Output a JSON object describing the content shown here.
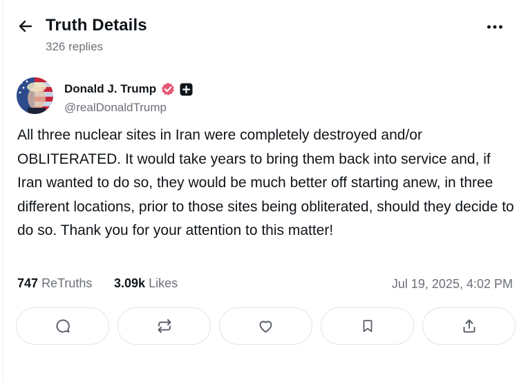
{
  "header": {
    "title": "Truth Details",
    "replies": "326 replies"
  },
  "post": {
    "author_name": "Donald J. Trump",
    "handle": "@realDonaldTrump",
    "text": "All three nuclear sites in Iran were completely destroyed and/or OBLITERATED. It would take years to bring them back into service and, if Iran wanted to do so, they would be much better off starting anew, in three different locations, prior to those sites being obliterated, should they decide to do so. Thank you for your attention to this matter!",
    "retruths_count": "747",
    "retruths_label": "ReTruths",
    "likes_count": "3.09k",
    "likes_label": "Likes",
    "timestamp": "Jul 19, 2025, 4:02 PM"
  },
  "icons": {
    "back": "arrow-left-icon",
    "more": "more-horizontal-icon",
    "verified": "verified-badge-icon",
    "plus": "plus-badge-icon",
    "reply": "reply-icon",
    "retruth": "retruth-icon",
    "like": "heart-icon",
    "bookmark": "bookmark-icon",
    "share": "share-icon"
  },
  "colors": {
    "text": "#0f1419",
    "muted": "#6b6f76",
    "verified": "#e85a76",
    "border": "#e3e4e7"
  }
}
